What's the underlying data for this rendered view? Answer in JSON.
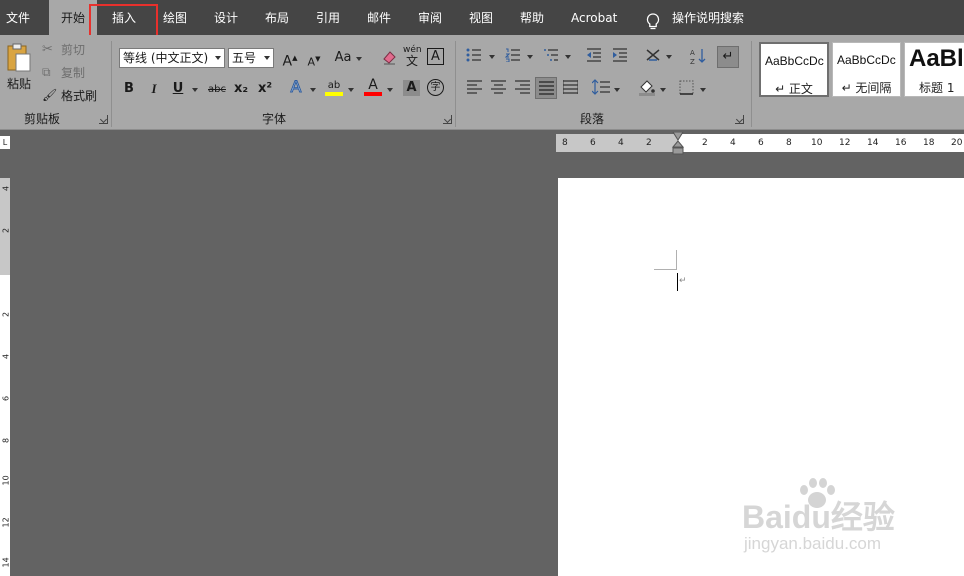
{
  "menu": {
    "tabs": [
      "文件",
      "开始",
      "插入",
      "绘图",
      "设计",
      "布局",
      "引用",
      "邮件",
      "审阅",
      "视图",
      "帮助",
      "Acrobat"
    ],
    "active_tab": "开始",
    "tell_me": "操作说明搜索"
  },
  "ribbon": {
    "clipboard": {
      "label": "剪贴板",
      "paste": "粘贴",
      "cut": "剪切",
      "copy": "复制",
      "format_painter": "格式刷"
    },
    "font": {
      "label": "字体",
      "font_name": "等线 (中文正文)",
      "font_size": "五号",
      "grow": "A",
      "shrink": "A",
      "change_case": "Aa",
      "phonetic_top": "wén",
      "phonetic_bottom": "文",
      "char_border": "A",
      "bold": "B",
      "italic": "I",
      "underline": "U",
      "strikethrough": "abc",
      "subscript": "x₂",
      "superscript": "x²",
      "text_effects": "A",
      "highlight": "ab",
      "font_color": "A",
      "char_shading": "A",
      "enclosed_char": "字"
    },
    "paragraph": {
      "label": "段落"
    },
    "styles": {
      "items": [
        {
          "sample": "AaBbCcDc",
          "name": "↵ 正文"
        },
        {
          "sample": "AaBbCcDc",
          "name": "↵ 无间隔"
        },
        {
          "sample": "AaBl",
          "name": "标题 1"
        }
      ]
    }
  },
  "ruler": {
    "corner": "L",
    "horizontal_ticks": [
      "8",
      "6",
      "4",
      "2",
      "2",
      "4",
      "6",
      "8",
      "10",
      "12",
      "14",
      "16",
      "18",
      "20"
    ],
    "vertical_ticks": [
      "4",
      "2",
      "2",
      "4",
      "6",
      "8",
      "10",
      "12",
      "14"
    ]
  },
  "document": {
    "paragraph_mark": "↵"
  },
  "watermark": {
    "brand": "Baidu经验",
    "url": "jingyan.baidu.com"
  },
  "colors": {
    "menubar": "#454545",
    "ribbon": "#a8a8a8",
    "workspace": "#636363",
    "highlight_box": "#e8302c",
    "highlight_yellow": "#ffff00",
    "font_red": "#ff0000"
  }
}
